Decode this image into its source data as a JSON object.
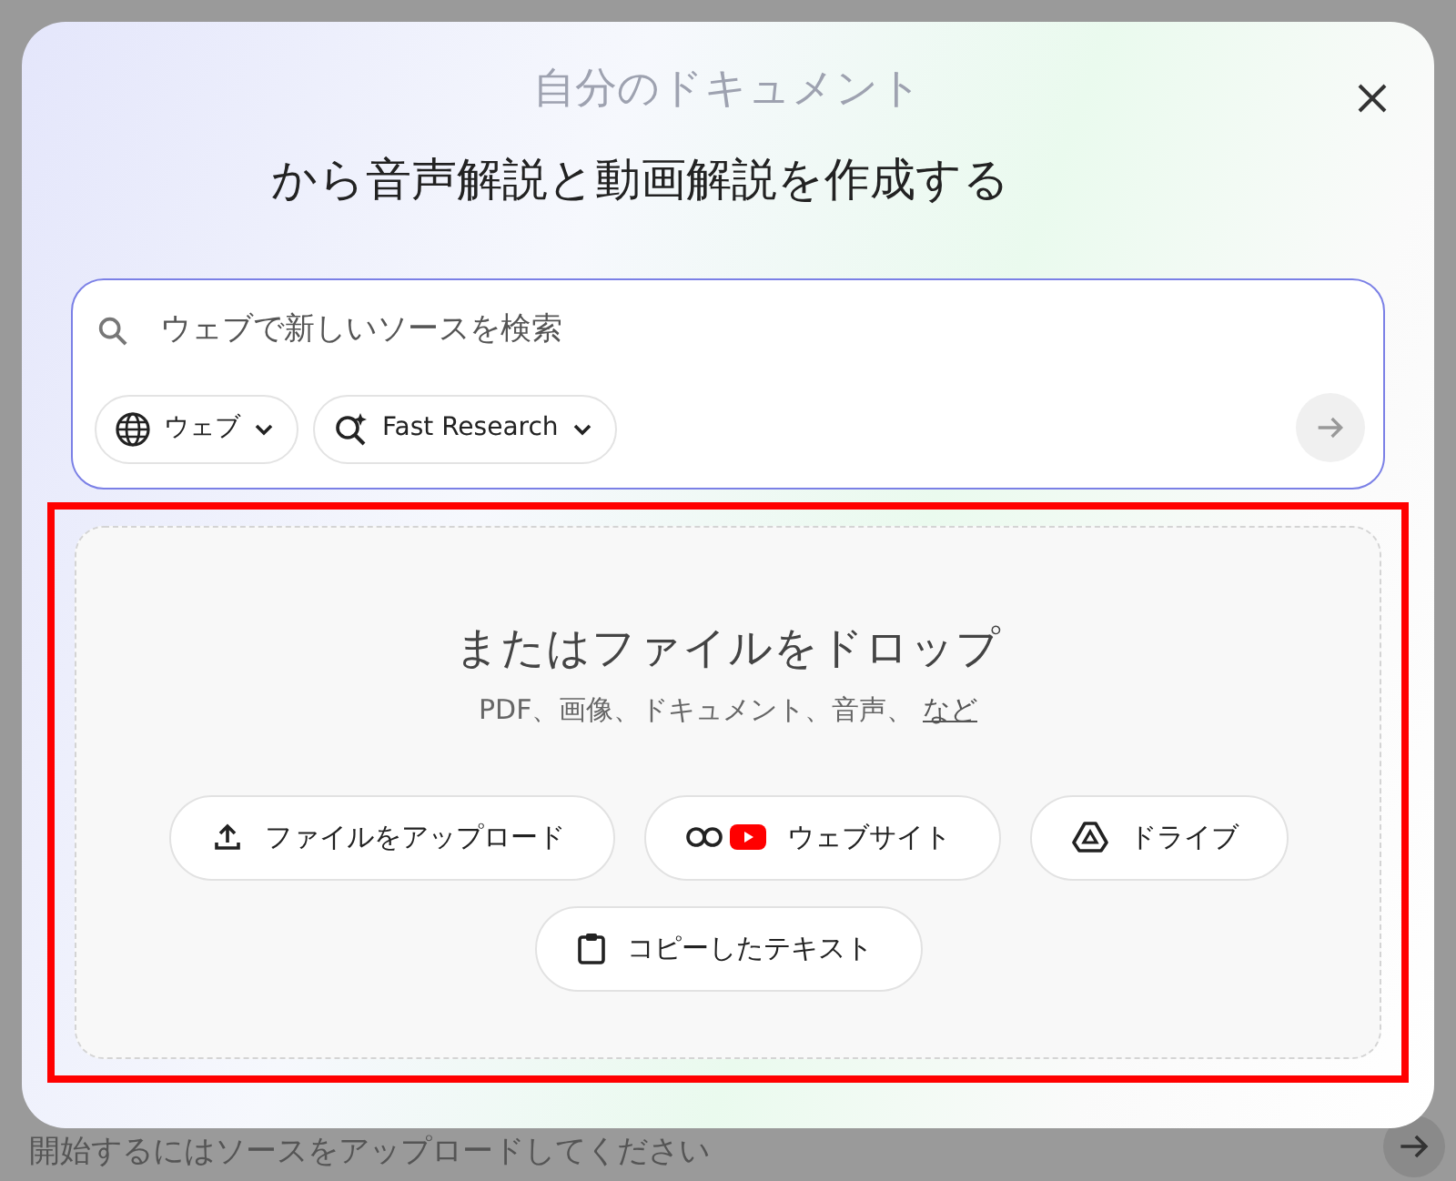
{
  "background": {
    "title": "自分のドキュメント",
    "prompt_placeholder": "開始するにはソースをアップロードしてください"
  },
  "dialog": {
    "title": "から音声解説と動画解説を作成する",
    "search": {
      "placeholder": "ウェブで新しいソースを検索",
      "chips": [
        {
          "kind": "globe",
          "label": "ウェブ"
        },
        {
          "kind": "research",
          "label": "Fast Research"
        }
      ]
    },
    "dropzone": {
      "highlighted": true,
      "heading": "またはファイルをドロップ",
      "subtitle": "PDF、画像、ドキュメント、音声、",
      "more_link": "など",
      "buttons": [
        {
          "kind": "upload",
          "label": "ファイルをアップロード"
        },
        {
          "kind": "website",
          "label": "ウェブサイト"
        },
        {
          "kind": "drive",
          "label": "ドライブ"
        },
        {
          "kind": "paste",
          "label": "コピーしたテキスト"
        }
      ]
    }
  }
}
